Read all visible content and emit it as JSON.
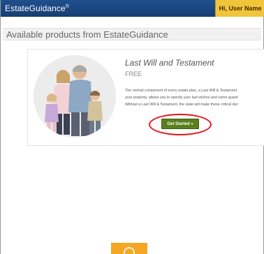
{
  "header": {
    "brand": "EstateGuidance",
    "brand_mark": "®",
    "user_greeting": "Hi, User Name"
  },
  "section": {
    "title": "Available products from EstateGuidance"
  },
  "product": {
    "title": "Last Will and Testament",
    "price": "FREE",
    "description_lines": [
      "The central component of every estate plan, a Last Will & Testament",
      "your property, allows you to specify your last wishes and name guard",
      "Without a Last Will & Testament, the state will make these critical dec"
    ],
    "cta_label": "Get Started »"
  },
  "colors": {
    "header_bg": "#1f4f8e",
    "user_badge_bg": "#f0c53a",
    "cta_bg": "#5a7f1d",
    "highlight": "#e8141e",
    "widget_bg": "#f5a623"
  },
  "icons": {
    "bottom_widget": "chat-bubble-icon"
  }
}
